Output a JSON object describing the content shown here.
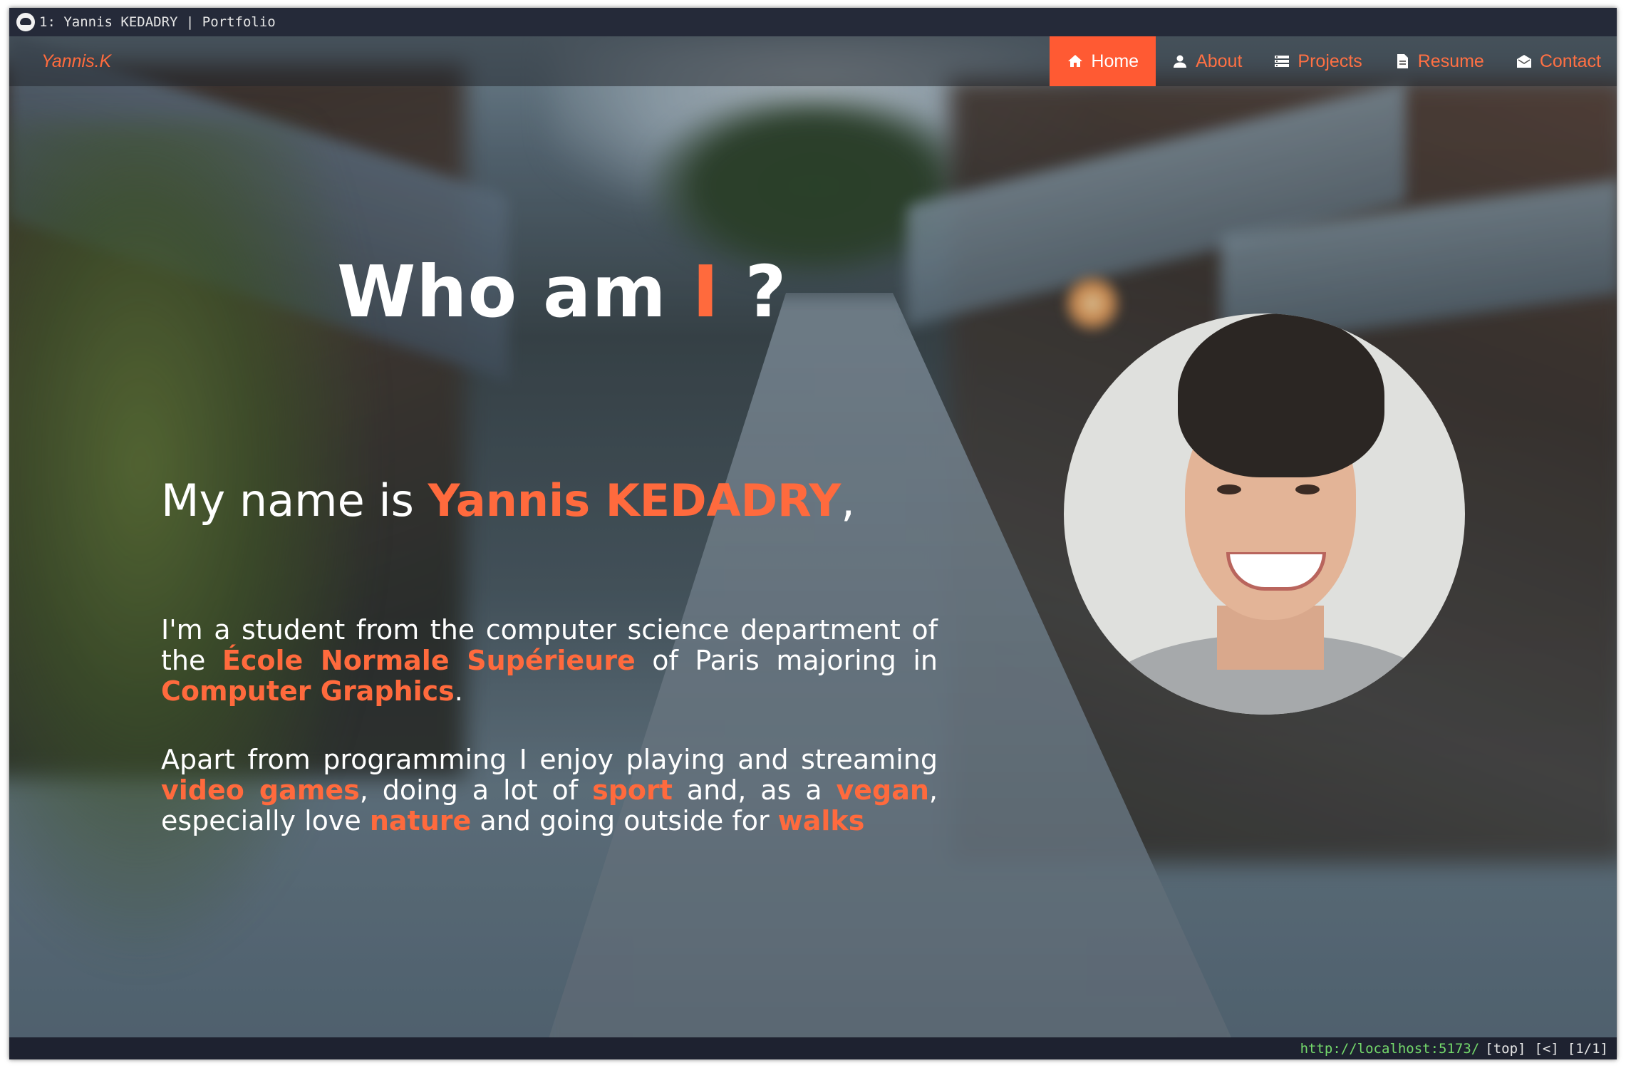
{
  "window": {
    "title": "1: Yannis KEDADRY | Portfolio"
  },
  "navbar": {
    "brand": "Yannis.K",
    "items": [
      {
        "label": "Home",
        "icon": "home-icon",
        "active": true
      },
      {
        "label": "About",
        "icon": "user-icon",
        "active": false
      },
      {
        "label": "Projects",
        "icon": "list-icon",
        "active": false
      },
      {
        "label": "Resume",
        "icon": "document-icon",
        "active": false
      },
      {
        "label": "Contact",
        "icon": "envelope-icon",
        "active": false
      }
    ]
  },
  "hero": {
    "title_prefix": "Who am ",
    "title_highlight": "I",
    "title_suffix": " ?",
    "name_prefix": "My name is ",
    "name_highlight": "Yannis KEDADRY",
    "name_suffix": ",",
    "para1": {
      "t1": "I'm a student from the computer science department of the ",
      "h1": "École Normale Supérieure",
      "t2": " of Paris majoring in ",
      "h2": "Computer Graphics",
      "t3": "."
    },
    "para2": {
      "t1": "Apart from programming I enjoy playing and streaming ",
      "h1": "video games",
      "t2": ", doing a lot of ",
      "h2": "sport",
      "t3": " and, as a ",
      "h3": "vegan",
      "t4": ", especially love ",
      "h4": "nature",
      "t5": " and going outside for ",
      "h5": "walks"
    }
  },
  "statusbar": {
    "url": "http://localhost:5173/",
    "scroll": "[top]",
    "history": "[<]",
    "tabs": "[1/1]"
  },
  "colors": {
    "accent": "#ff6a3d",
    "nav_active_bg": "#ff5a33",
    "statusbar_url": "#74d96b",
    "chrome_bg": "#1e2230"
  }
}
